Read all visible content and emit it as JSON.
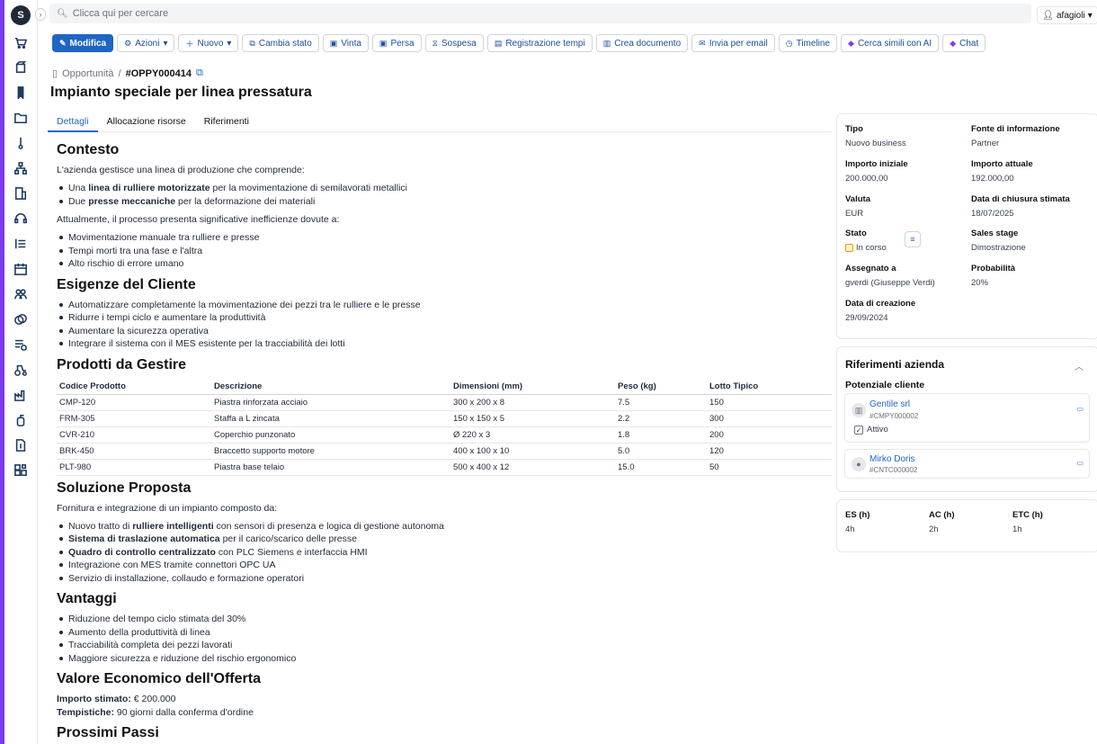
{
  "search": {
    "placeholder": "Clicca qui per cercare"
  },
  "user": {
    "name": "afagioli"
  },
  "sidebar": {
    "logo": "S"
  },
  "toolbar": {
    "modifica": "Modifica",
    "azioni": "Azioni",
    "nuovo": "Nuovo",
    "cambia_stato": "Cambia stato",
    "vinta": "Vinta",
    "persa": "Persa",
    "sospesa": "Sospesa",
    "registrazione": "Registrazione tempi",
    "crea_doc": "Crea documento",
    "invia_email": "Invia per email",
    "timeline": "Timeline",
    "cerca_simili": "Cerca simili con AI",
    "chat": "Chat"
  },
  "breadcrumb": {
    "parent": "Opportunità",
    "sep": "/",
    "code": "#OPPY000414"
  },
  "page": {
    "title": "Impianto speciale per linea pressatura"
  },
  "tabs": [
    "Dettagli",
    "Allocazione risorse",
    "Riferimenti"
  ],
  "content": {
    "contesto": {
      "title": "Contesto",
      "intro": "L'azienda gestisce una linea di produzione che comprende:",
      "b1_pre": "Una ",
      "b1_bold": "linea di rulliere motorizzate",
      "b1_post": " per la movimentazione di semilavorati metallici",
      "b2_pre": "Due ",
      "b2_bold": "presse meccaniche",
      "b2_post": " per la deformazione dei materiali",
      "intro2": "Attualmente, il processo presenta significative inefficienze dovute a:",
      "items": [
        "Movimentazione manuale tra rulliere e presse",
        "Tempi morti tra una fase e l'altra",
        "Alto rischio di errore umano"
      ]
    },
    "esigenze": {
      "title": "Esigenze del Cliente",
      "items": [
        "Automatizzare completamente la movimentazione dei pezzi tra le rulliere e le presse",
        "Ridurre i tempi ciclo e aumentare la produttività",
        "Aumentare la sicurezza operativa",
        "Integrare il sistema con il MES esistente per la tracciabilità dei lotti"
      ]
    },
    "prodotti": {
      "title": "Prodotti da Gestire",
      "headers": [
        "Codice Prodotto",
        "Descrizione",
        "Dimensioni (mm)",
        "Peso (kg)",
        "Lotto Tipico"
      ],
      "rows": [
        [
          "CMP-120",
          "Piastra rinforzata acciaio",
          "300 x 200 x 8",
          "7.5",
          "150"
        ],
        [
          "FRM-305",
          "Staffa a L zincata",
          "150 x 150 x 5",
          "2.2",
          "300"
        ],
        [
          "CVR-210",
          "Coperchio punzonato",
          "Ø 220 x 3",
          "1.8",
          "200"
        ],
        [
          "BRK-450",
          "Braccetto supporto motore",
          "400 x 100 x 10",
          "5.0",
          "120"
        ],
        [
          "PLT-980",
          "Piastra base telaio",
          "500 x 400 x 12",
          "15.0",
          "50"
        ]
      ]
    },
    "soluzione": {
      "title": "Soluzione Proposta",
      "intro": "Fornitura e integrazione di un impianto composto da:",
      "b1_pre": "Nuovo tratto di ",
      "b1_bold": "rulliere intelligenti",
      "b1_post": " con sensori di presenza e logica di gestione autonoma",
      "b2_bold": "Sistema di traslazione automatica",
      "b2_post": " per il carico/scarico delle presse",
      "b3_bold": "Quadro di controllo centralizzato",
      "b3_post": " con PLC Siemens e interfaccia HMI",
      "b4": "Integrazione con MES tramite connettori OPC UA",
      "b5": "Servizio di installazione, collaudo e formazione operatori"
    },
    "vantaggi": {
      "title": "Vantaggi",
      "items": [
        "Riduzione del tempo ciclo stimata del 30%",
        "Aumento della produttività di linea",
        "Tracciabilità completa dei pezzi lavorati",
        "Maggiore sicurezza e riduzione del rischio ergonomico"
      ]
    },
    "valore": {
      "title": "Valore Economico dell'Offerta",
      "l1_bold": "Importo stimato:",
      "l1_val": " € 200.000",
      "l2_bold": "Tempistiche:",
      "l2_val": " 90 giorni dalla conferma d'ordine"
    },
    "prossimi": {
      "title": "Prossimi Passi"
    }
  },
  "details": {
    "tipo_l": "Tipo",
    "tipo_v": "Nuovo business",
    "fonte_l": "Fonte di informazione",
    "fonte_v": "Partner",
    "imp_in_l": "Importo iniziale",
    "imp_in_v": "200.000,00",
    "imp_att_l": "Importo attuale",
    "imp_att_v": "192.000,00",
    "valuta_l": "Valuta",
    "valuta_v": "EUR",
    "chiusura_l": "Data di chiusura stimata",
    "chiusura_v": "18/07/2025",
    "stato_l": "Stato",
    "stato_v": "In corso",
    "stage_l": "Sales stage",
    "stage_v": "Dimostrazione",
    "assegnato_l": "Assegnato a",
    "assegnato_v": "gverdi (Giuseppe Verdi)",
    "prob_l": "Probabilità",
    "prob_v": "20%",
    "creazione_l": "Data di creazione",
    "creazione_v": "29/09/2024"
  },
  "refs": {
    "title": "Riferimenti azienda",
    "subtitle": "Potenziale cliente",
    "company": {
      "name": "Gentile srl",
      "code": "#CMPY000002",
      "status": "Attivo"
    },
    "contact": {
      "name": "Mirko Doris",
      "code": "#CNTC000002"
    }
  },
  "hours": {
    "es_l": "ES (h)",
    "es_v": "4h",
    "ac_l": "AC (h)",
    "ac_v": "2h",
    "etc_l": "ETC (h)",
    "etc_v": "1h"
  },
  "colors": {
    "accent": "#1e66c4",
    "brand": "#7c3aed"
  }
}
